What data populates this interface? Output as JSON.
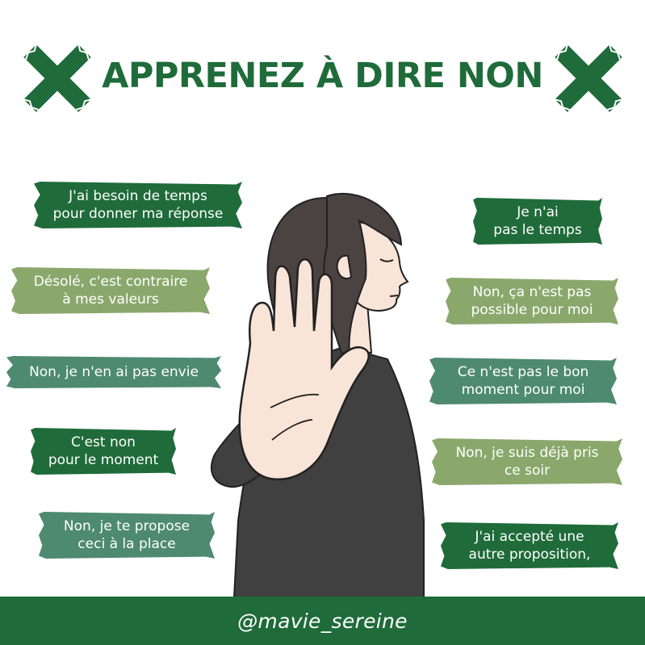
{
  "colors": {
    "title": "#1f6b3a",
    "footer_bg": "#1f6b3a",
    "tape_dark_green": "#1f6b3a",
    "tape_sage": "#8aa86c",
    "tape_teal": "#4e8a70",
    "hair": "#4a4342",
    "sweater": "#404040",
    "skin": "#f9e4d8",
    "outline": "#222222"
  },
  "title": {
    "text": "APPRENEZ À DIRE NON",
    "left_icon": "x-mark-icon",
    "right_icon": "x-mark-icon"
  },
  "phrases_left": [
    {
      "line1": "J'ai besoin de temps",
      "line2": "pour donner ma réponse",
      "color": "#1f6b3a"
    },
    {
      "line1": "Désolé, c'est contraire",
      "line2": "à mes valeurs",
      "color": "#8aa86c"
    },
    {
      "line1": "Non, je n'en ai pas envie",
      "line2": "",
      "color": "#4e8a70"
    },
    {
      "line1": "C'est non",
      "line2": "pour le moment",
      "color": "#1f6b3a"
    },
    {
      "line1": "Non, je te propose",
      "line2": "ceci à la place",
      "color": "#4e8a70"
    }
  ],
  "phrases_right": [
    {
      "line1": "Je n'ai",
      "line2": "pas le temps",
      "color": "#1f6b3a"
    },
    {
      "line1": "Non, ça n'est pas",
      "line2": "possible pour moi",
      "color": "#8aa86c"
    },
    {
      "line1": "Ce n'est pas le bon",
      "line2": "moment pour moi",
      "color": "#4e8a70"
    },
    {
      "line1": "Non, je suis déjà pris",
      "line2": "ce soir",
      "color": "#8aa86c"
    },
    {
      "line1": "J'ai accepté une",
      "line2": "autre proposition,",
      "color": "#1f6b3a"
    }
  ],
  "illustration": {
    "icon": "woman-stop-hand-illustration"
  },
  "footer": {
    "handle": "@mavie_sereine"
  }
}
